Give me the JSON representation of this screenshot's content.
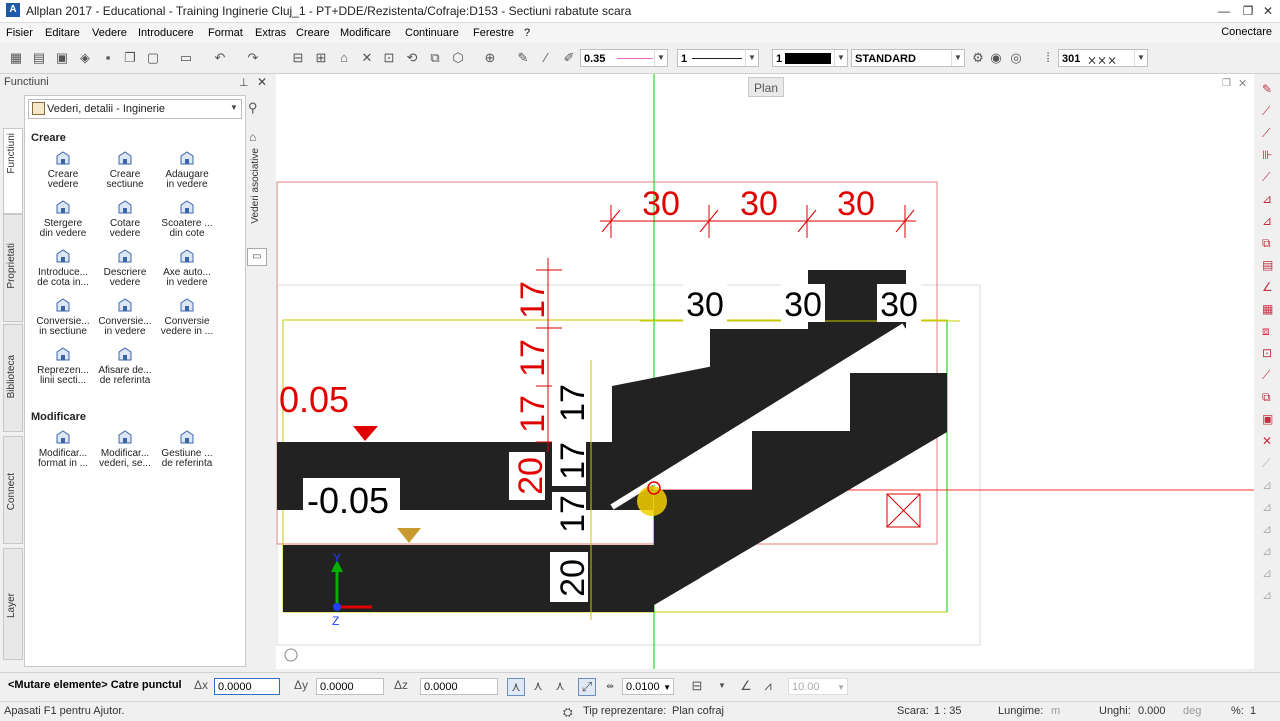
{
  "window": {
    "title": "Allplan 2017 - Educational - Training Inginerie Cluj_1 - PT+DDE/Rezistenta/Cofraje:D153 - Sectiuni rabatute scara",
    "app_icon": "A"
  },
  "menu": {
    "items": [
      "Fisier",
      "Editare",
      "Vedere",
      "Introducere",
      "Format",
      "Extras",
      "Creare",
      "Modificare",
      "Continuare",
      "Ferestre",
      "?"
    ],
    "connect_label": "Conectare"
  },
  "toolbar": {
    "pen_value": "0.35",
    "line_value": "1",
    "color_value": "1",
    "layer_value": "STANDARD",
    "hatch_value": "301"
  },
  "palette": {
    "title": "Functiuni",
    "tabs": [
      "Functiuni",
      "Proprietati",
      "Biblioteca",
      "Connect",
      "Layer"
    ],
    "side_tab": "Vederi asociative",
    "dropdown_value": "Vederi, detalii - Inginerie",
    "sections": [
      {
        "title": "Creare",
        "tools": [
          {
            "line1": "Creare",
            "line2": "vedere"
          },
          {
            "line1": "Creare",
            "line2": "sectiune"
          },
          {
            "line1": "Adaugare",
            "line2": "in vedere"
          },
          {
            "line1": "Stergere",
            "line2": "din vedere"
          },
          {
            "line1": "Cotare",
            "line2": "vedere"
          },
          {
            "line1": "Scoatere ...",
            "line2": "din cote"
          },
          {
            "line1": "Introduce...",
            "line2": "de cota in..."
          },
          {
            "line1": "Descriere",
            "line2": "vedere"
          },
          {
            "line1": "Axe auto...",
            "line2": "in vedere"
          },
          {
            "line1": "Conversie...",
            "line2": "in sectiune"
          },
          {
            "line1": "Conversie...",
            "line2": "in vedere"
          },
          {
            "line1": "Conversie",
            "line2": "vedere in ..."
          },
          {
            "line1": "Reprezen...",
            "line2": "linii secti..."
          },
          {
            "line1": "Afisare de...",
            "line2": "de referinta"
          }
        ]
      },
      {
        "title": "Modificare",
        "tools": [
          {
            "line1": "Modificar...",
            "line2": "format in ..."
          },
          {
            "line1": "Modificar...",
            "line2": "vederi, se..."
          },
          {
            "line1": "Gestiune ...",
            "line2": "de referinta"
          }
        ]
      }
    ]
  },
  "drawing": {
    "tooltip": "Plan",
    "dims_top": [
      "30",
      "30",
      "30"
    ],
    "dims_inner": [
      "30",
      "30",
      "30"
    ],
    "dims_left_outer": [
      "17",
      "17",
      "17"
    ],
    "dims_left_inner": [
      "17",
      "17",
      "17"
    ],
    "dim_slab_upper": "20",
    "dim_slab_lower": "20",
    "level_top": "0.05",
    "level_mid": "-0.05",
    "axis_y": "Y",
    "axis_z": "Z",
    "colors": {
      "dim_red": "#e00000",
      "fill": "#222222",
      "axis_green": "#00cc00",
      "border_yellow": "#c8c800"
    }
  },
  "coords": {
    "prompt": "<Mutare elemente> Catre punctul",
    "dx_label": "Δx",
    "dx_value": "0.0000",
    "dy_label": "Δy",
    "dy_value": "0.0000",
    "dz_label": "Δz",
    "dz_value": "0.0000",
    "step_value": "0.0100",
    "angle_value": "10.00"
  },
  "status": {
    "help": "Apasati F1 pentru Ajutor.",
    "repr_label": "Tip reprezentare:",
    "repr_value": "Plan cofraj",
    "scale_label": "Scara:",
    "scale_value": "1 : 35",
    "length_label": "Lungime:",
    "length_unit": "m",
    "angle_label": "Unghi:",
    "angle_value": "0.000",
    "angle_unit": "deg",
    "percent_label": "%:",
    "percent_value": "1"
  }
}
